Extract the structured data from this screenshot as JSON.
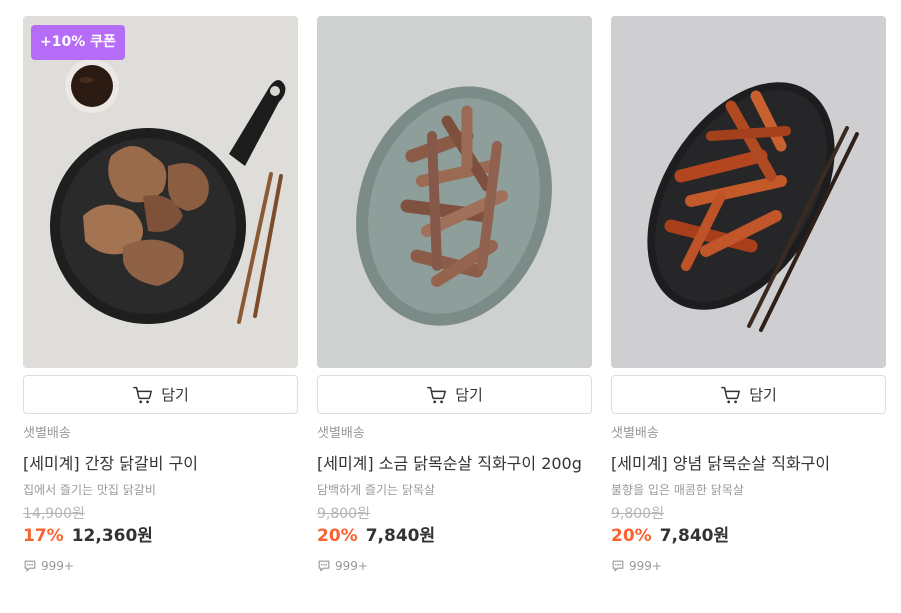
{
  "cart_label": "담기",
  "coupon_badge": "+10% 쿠폰",
  "products": [
    {
      "delivery": "샛별배송",
      "name": "[세미계] 간장 닭갈비 구이",
      "description": "집에서 즐기는 맛집 닭갈비",
      "original_price": "14,900원",
      "discount": "17%",
      "price": "12,360원",
      "reviews": "999+"
    },
    {
      "delivery": "샛별배송",
      "name": "[세미계] 소금 닭목순살 직화구이 200g",
      "description": "담백하게 즐기는 닭목살",
      "original_price": "9,800원",
      "discount": "20%",
      "price": "7,840원",
      "reviews": "999+"
    },
    {
      "delivery": "샛별배송",
      "name": "[세미계] 양념 닭목순살 직화구이",
      "description": "불향을 입은 매콤한 닭목살",
      "original_price": "9,800원",
      "discount": "20%",
      "price": "7,840원",
      "reviews": "999+"
    }
  ],
  "colors": {
    "coupon_bg": "#b56df7",
    "discount": "#fa622f",
    "muted_text": "#999999"
  }
}
